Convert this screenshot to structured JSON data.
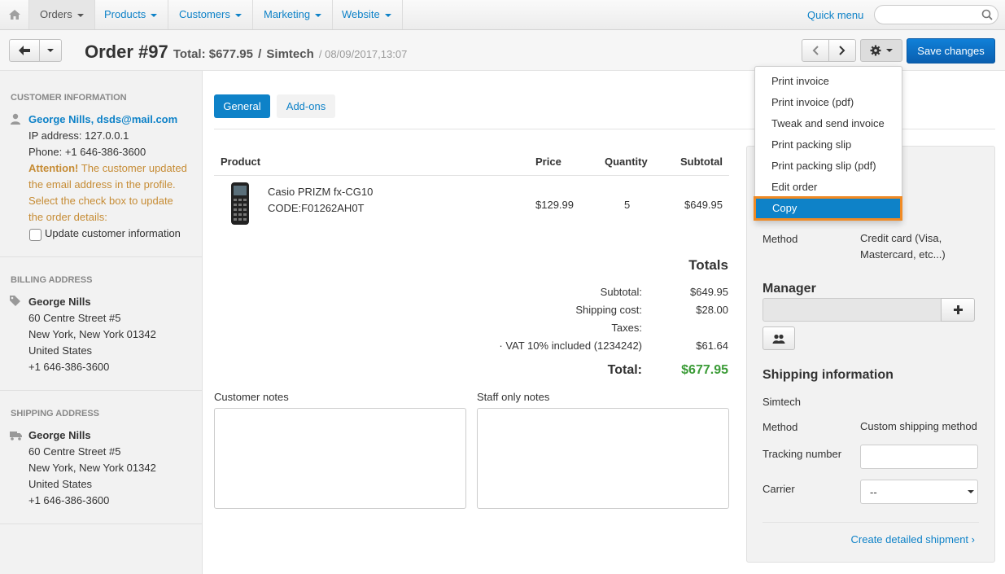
{
  "nav": {
    "items": [
      {
        "label": "Orders"
      },
      {
        "label": "Products"
      },
      {
        "label": "Customers"
      },
      {
        "label": "Marketing"
      },
      {
        "label": "Website"
      }
    ],
    "quick_menu": "Quick menu",
    "search_placeholder": ""
  },
  "header": {
    "title": "Order #97",
    "total": "Total: $677.95",
    "separator": "/",
    "vendor": "Simtech",
    "date": "/ 08/09/2017,13:07",
    "save_label": "Save changes"
  },
  "sidebar": {
    "customer": {
      "heading": "Customer information",
      "name_email": "George Nills, dsds@mail.com",
      "ip": "IP address: 127.0.0.1",
      "phone": "Phone: +1 646-386-3600",
      "attention": "Attention!",
      "warn_1": "The customer updated",
      "warn_2": "the email address in the profile.",
      "warn_3": "Select the check box to update",
      "warn_4": "the order details:",
      "checkbox_label": "Update customer information"
    },
    "billing": {
      "heading": "Billing address",
      "name": "George Nills",
      "street": "60 Centre Street #5",
      "city": "New York, New York 01342",
      "country": "United States",
      "phone": "+1 646-386-3600"
    },
    "shipping": {
      "heading": "Shipping address",
      "name": "George Nills",
      "street": "60 Centre Street #5",
      "city": "New York, New York 01342",
      "country": "United States",
      "phone": "+1 646-386-3600"
    }
  },
  "tabs": [
    {
      "label": "General"
    },
    {
      "label": "Add-ons"
    }
  ],
  "table": {
    "headers": {
      "product": "Product",
      "price": "Price",
      "quantity": "Quantity",
      "subtotal": "Subtotal"
    },
    "rows": [
      {
        "name": "Casio PRIZM fx-CG10",
        "code": "CODE:F01262AH0T",
        "price": "$129.99",
        "quantity": "5",
        "subtotal": "$649.95"
      }
    ]
  },
  "totals": {
    "heading": "Totals",
    "subtotal_label": "Subtotal:",
    "subtotal_value": "$649.95",
    "shipping_label": "Shipping cost:",
    "shipping_value": "$28.00",
    "taxes_label": "Taxes:",
    "vat_label": "· VAT 10% included (1234242)",
    "vat_value": "$61.64",
    "total_label": "Total:",
    "total_value": "$677.95"
  },
  "notes": {
    "customer_label": "Customer notes",
    "staff_label": "Staff only notes"
  },
  "right_panel": {
    "payment_method_label": "Method",
    "payment_method_value_1": "Credit card (Visa,",
    "payment_method_value_2": "Mastercard, etc...)",
    "manager_heading": "Manager",
    "shipping_heading": "Shipping information",
    "shipping_vendor": "Simtech",
    "shipping_method_label": "Method",
    "shipping_method_value": "Custom shipping method",
    "tracking_label": "Tracking number",
    "carrier_label": "Carrier",
    "carrier_value": "--",
    "create_shipment": "Create detailed shipment ›"
  },
  "dropdown": {
    "items": [
      {
        "label": "Print invoice"
      },
      {
        "label": "Print invoice (pdf)"
      },
      {
        "label": "Tweak and send invoice"
      },
      {
        "label": "Print packing slip"
      },
      {
        "label": "Print packing slip (pdf)"
      },
      {
        "label": "Edit order"
      },
      {
        "label": "Copy"
      }
    ],
    "selected": "Copy"
  },
  "colors": {
    "accent": "#0e82c8",
    "total_green": "#3c9c38",
    "warning": "#c68c35",
    "highlight_outline": "#f08a24"
  }
}
